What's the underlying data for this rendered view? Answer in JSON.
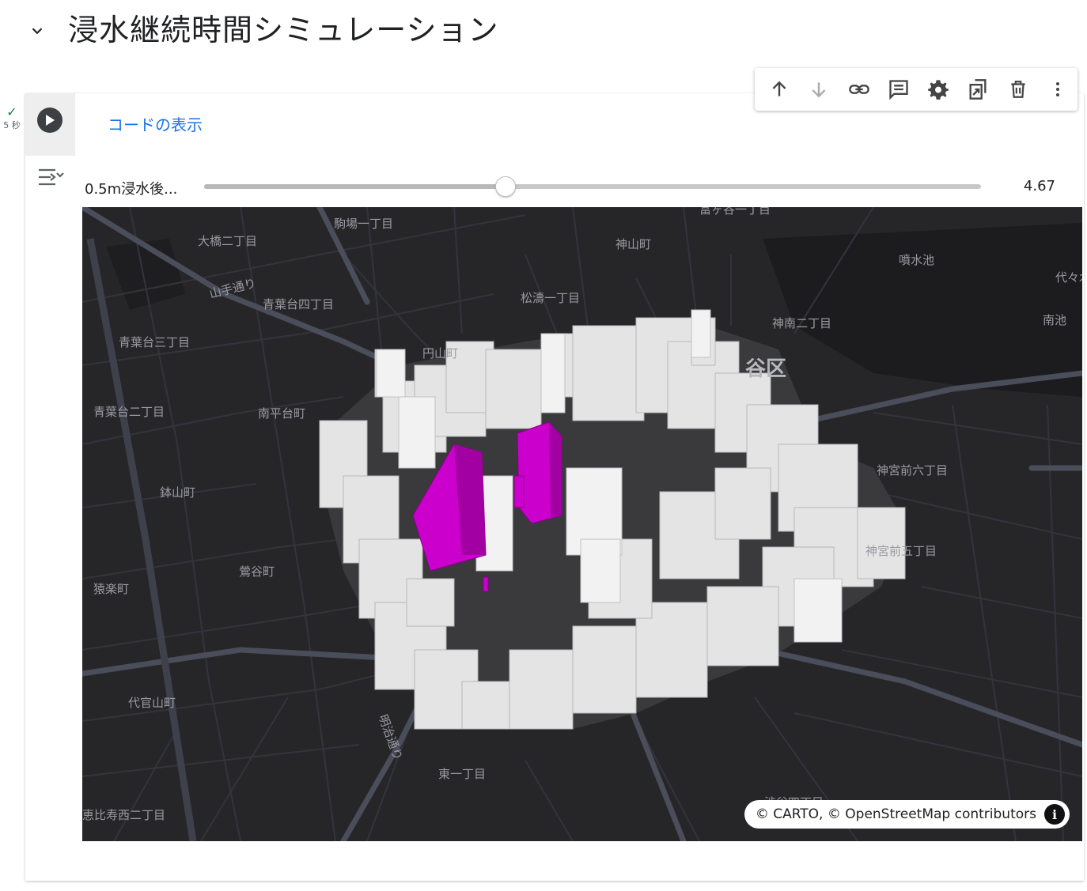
{
  "section": {
    "title": "浸水継続時間シミュレーション"
  },
  "run_status": {
    "check": "✓",
    "time": "5 秒"
  },
  "cell": {
    "show_code_label": "コードの表示"
  },
  "toolbar": {
    "buttons": [
      {
        "icon": "arrow-up-icon"
      },
      {
        "icon": "arrow-down-icon"
      },
      {
        "icon": "link-icon"
      },
      {
        "icon": "comment-icon"
      },
      {
        "icon": "gear-icon"
      },
      {
        "icon": "mirror-cell-icon"
      },
      {
        "icon": "trash-icon"
      },
      {
        "icon": "more-vert-icon"
      }
    ]
  },
  "slider": {
    "label": "0.5m浸水後...",
    "value": 4.67,
    "value_text": "4.67",
    "fraction": 0.387
  },
  "map": {
    "labels": [
      "駒場一丁目",
      "大橋二丁目",
      "神山町",
      "噴水池",
      "代々木",
      "青葉台四丁目",
      "松濤一丁目",
      "神南二丁目",
      "南池",
      "青葉台三丁目",
      "円山町",
      "谷区",
      "青葉台二丁目",
      "南平台町",
      "神宮前六丁目",
      "鉢山町",
      "神宮前五丁目",
      "鶯谷町",
      "猿楽町",
      "代官山町",
      "東一丁目",
      "恵比寿西二丁目",
      "渋谷四丁目",
      "山手通り",
      "明治通り",
      "富ヶ谷一丁目"
    ],
    "attribution": "© CARTO, © OpenStreetMap contributors",
    "colors": {
      "background": "#262629",
      "building": "#e4e4e4",
      "flooded": "#cc00cc",
      "road": "#4a4d5a"
    }
  }
}
